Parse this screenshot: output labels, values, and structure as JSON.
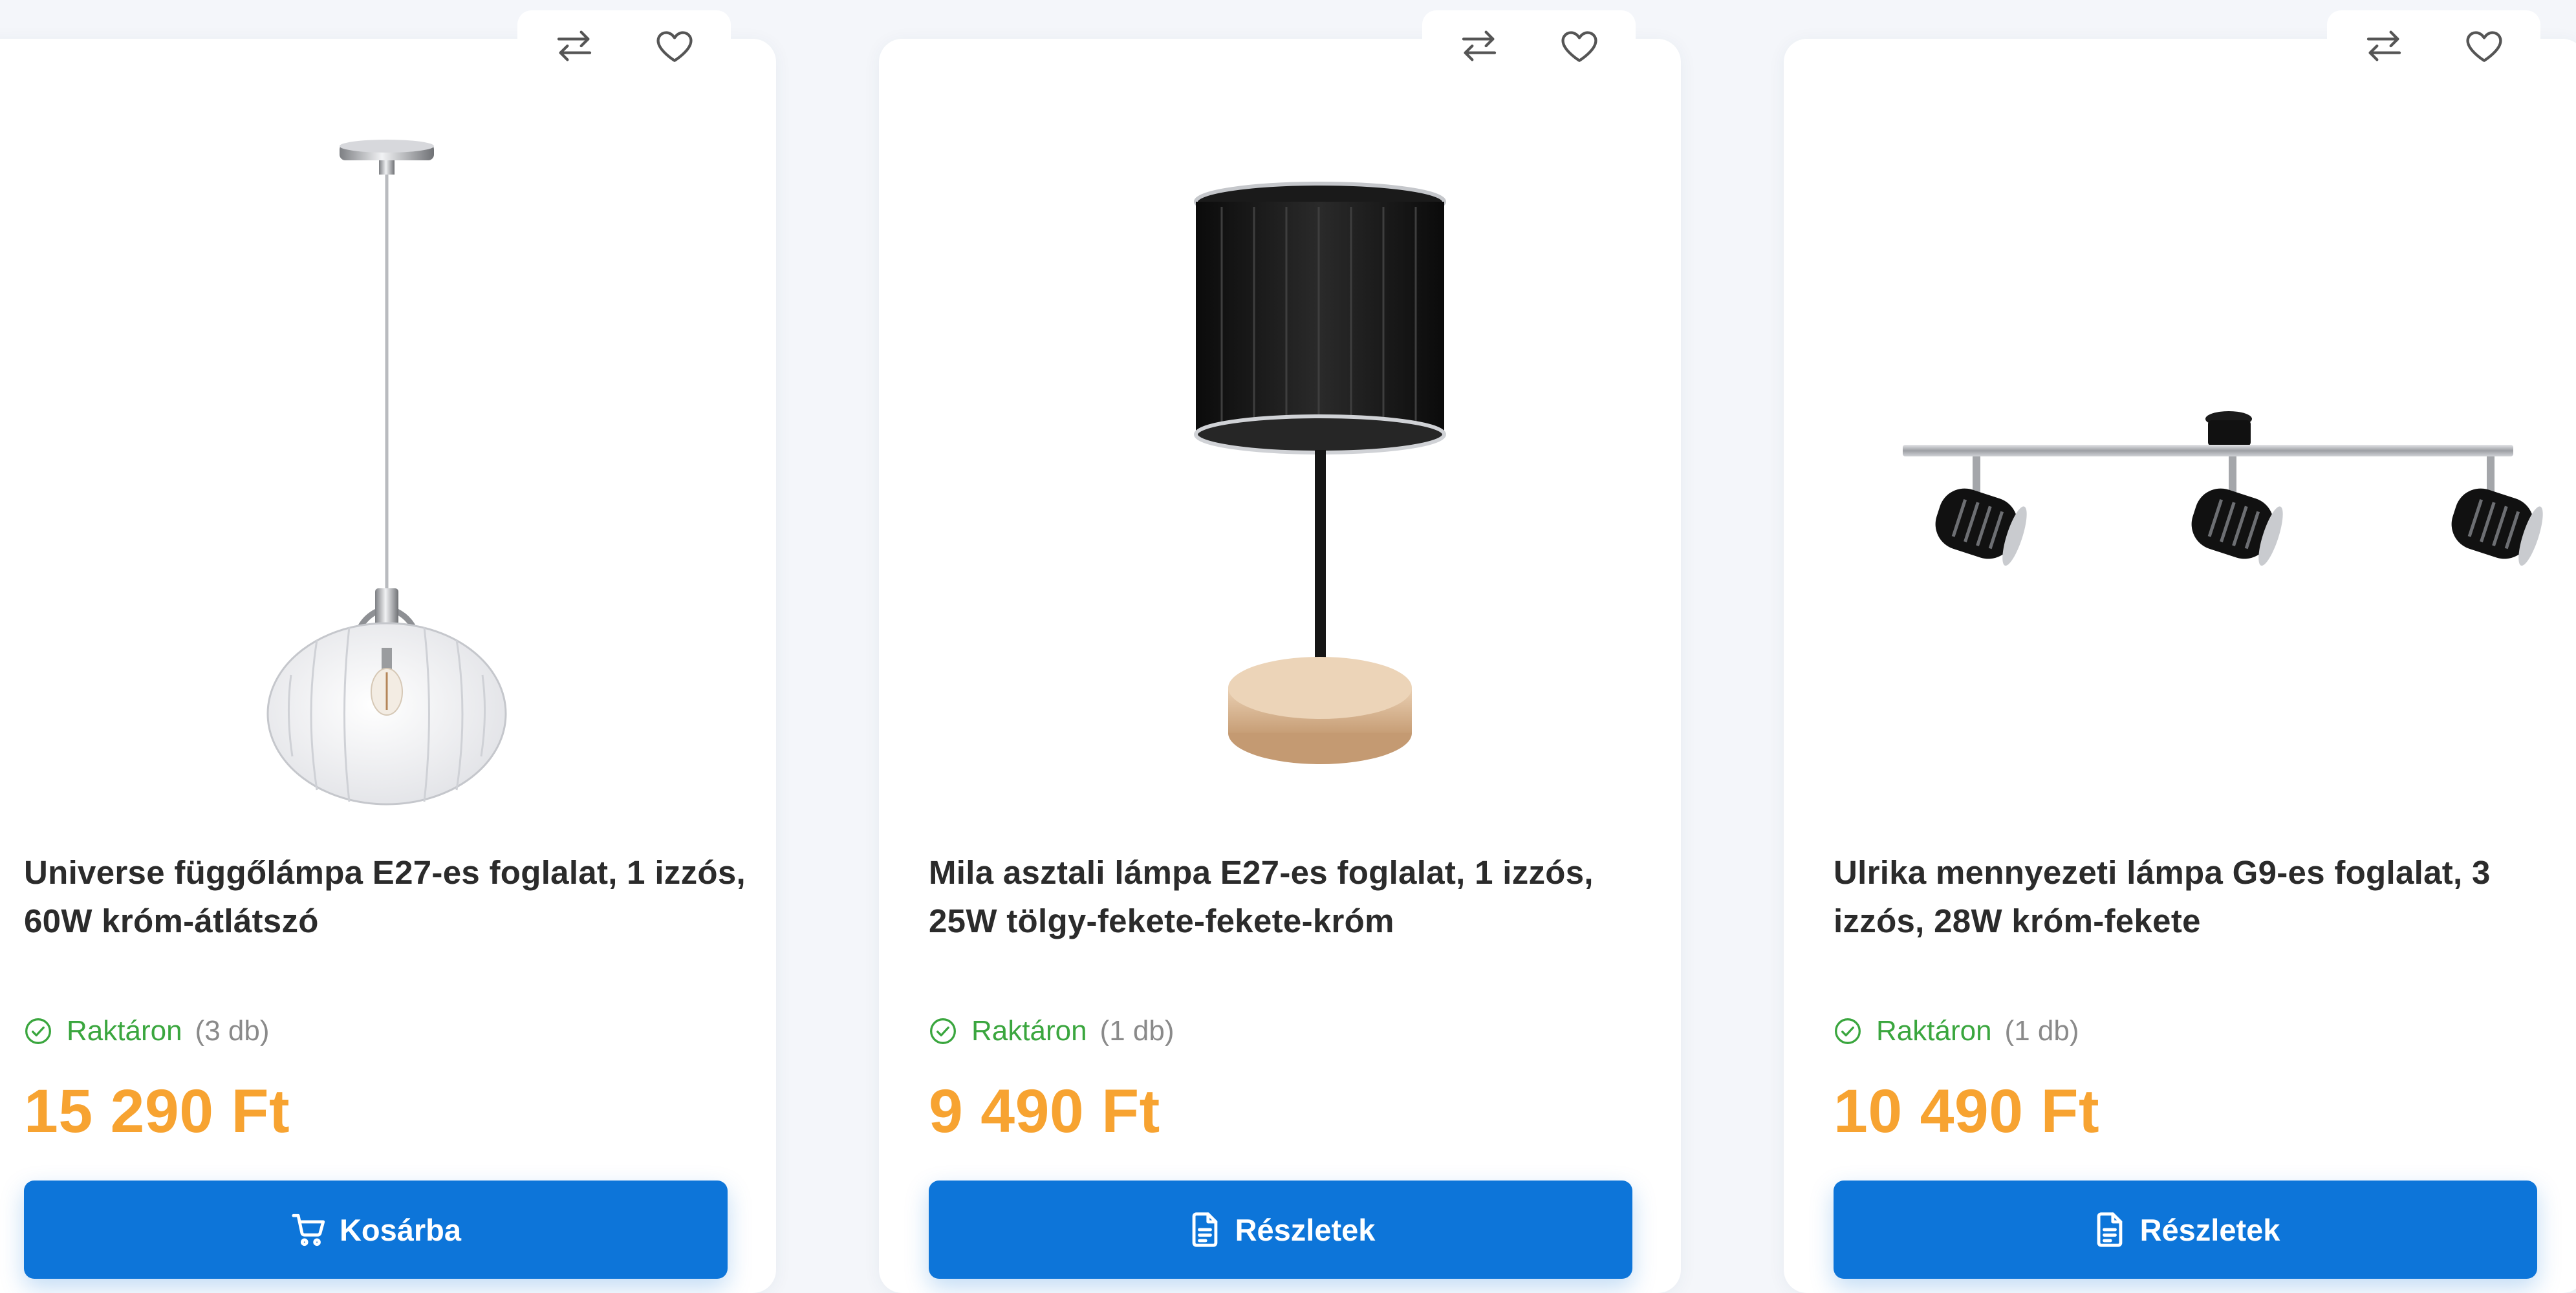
{
  "products": [
    {
      "title": "Universe függőlámpa E27-es foglalat, 1 izzós, 60W króm-átlátszó",
      "stock_label": "Raktáron",
      "stock_qty": "(3 db)",
      "price": "15 290 Ft",
      "cta_label": "Kosárba",
      "cta_icon": "cart-icon",
      "image_alt": "Universe függőlámpa"
    },
    {
      "title": "Mila asztali lámpa E27-es foglalat, 1 izzós, 25W tölgy-fekete-fekete-króm",
      "stock_label": "Raktáron",
      "stock_qty": "(1 db)",
      "price": "9 490 Ft",
      "cta_label": "Részletek",
      "cta_icon": "document-icon",
      "image_alt": "Mila asztali lámpa"
    },
    {
      "title": "Ulrika mennyezeti lámpa G9-es foglalat, 3 izzós, 28W króm-fekete",
      "stock_label": "Raktáron",
      "stock_qty": "(1 db)",
      "price": "10 490 Ft",
      "cta_label": "Részletek",
      "cta_icon": "document-icon",
      "image_alt": "Ulrika mennyezeti lámpa"
    }
  ],
  "icons": {
    "compare": "compare-arrows-icon",
    "wishlist": "heart-icon",
    "stock": "check-circle-icon"
  },
  "colors": {
    "price": "#f7a331",
    "cta": "#0d75d9",
    "stock": "#3aa63e",
    "qty": "#8a8a8a",
    "title": "#2b2b2b"
  }
}
